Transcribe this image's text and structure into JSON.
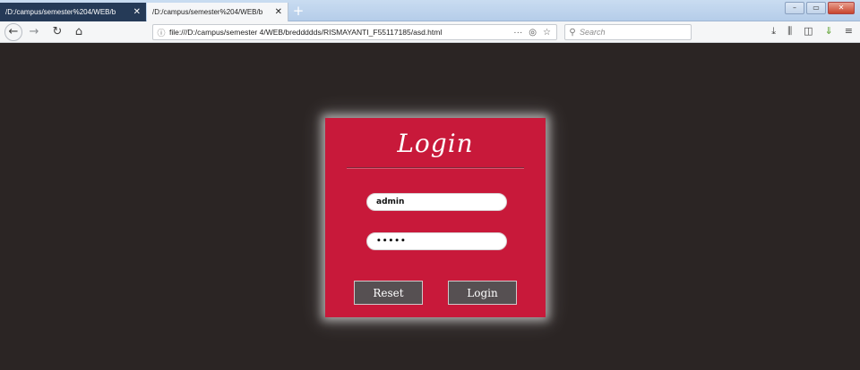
{
  "browser": {
    "tabs": [
      {
        "title": "/D:/campus/semester%204/WEB/b",
        "close": "✕",
        "active": false
      },
      {
        "title": "/D:/campus/semester%204/WEB/b",
        "close": "✕",
        "active": true
      }
    ],
    "new_tab": "+",
    "window_controls": {
      "minimize": "–",
      "maximize": "▭",
      "close": "✕"
    },
    "nav": {
      "back": "←",
      "forward": "→",
      "reload": "↻",
      "home": "⌂"
    },
    "url": "file:///D:/campus/semester 4/WEB/breddddds/RISMAYANTI_F55117185/asd.html",
    "url_info_icon": "ⓘ",
    "url_actions": {
      "more": "···",
      "pocket": "◎",
      "bookmark": "☆"
    },
    "search": {
      "icon": "⚲",
      "placeholder": "Search"
    },
    "toolbar": {
      "download": "⤓",
      "library": "⫼",
      "sidebar": "◫",
      "addon": "⇓",
      "menu": "≡"
    }
  },
  "login": {
    "title": "Login",
    "username_value": "admin",
    "password_value": "•••••",
    "reset_label": "Reset",
    "login_label": "Login"
  },
  "colors": {
    "page_background": "#2b2524",
    "card_background": "#c8193a",
    "button_background": "#565052"
  }
}
